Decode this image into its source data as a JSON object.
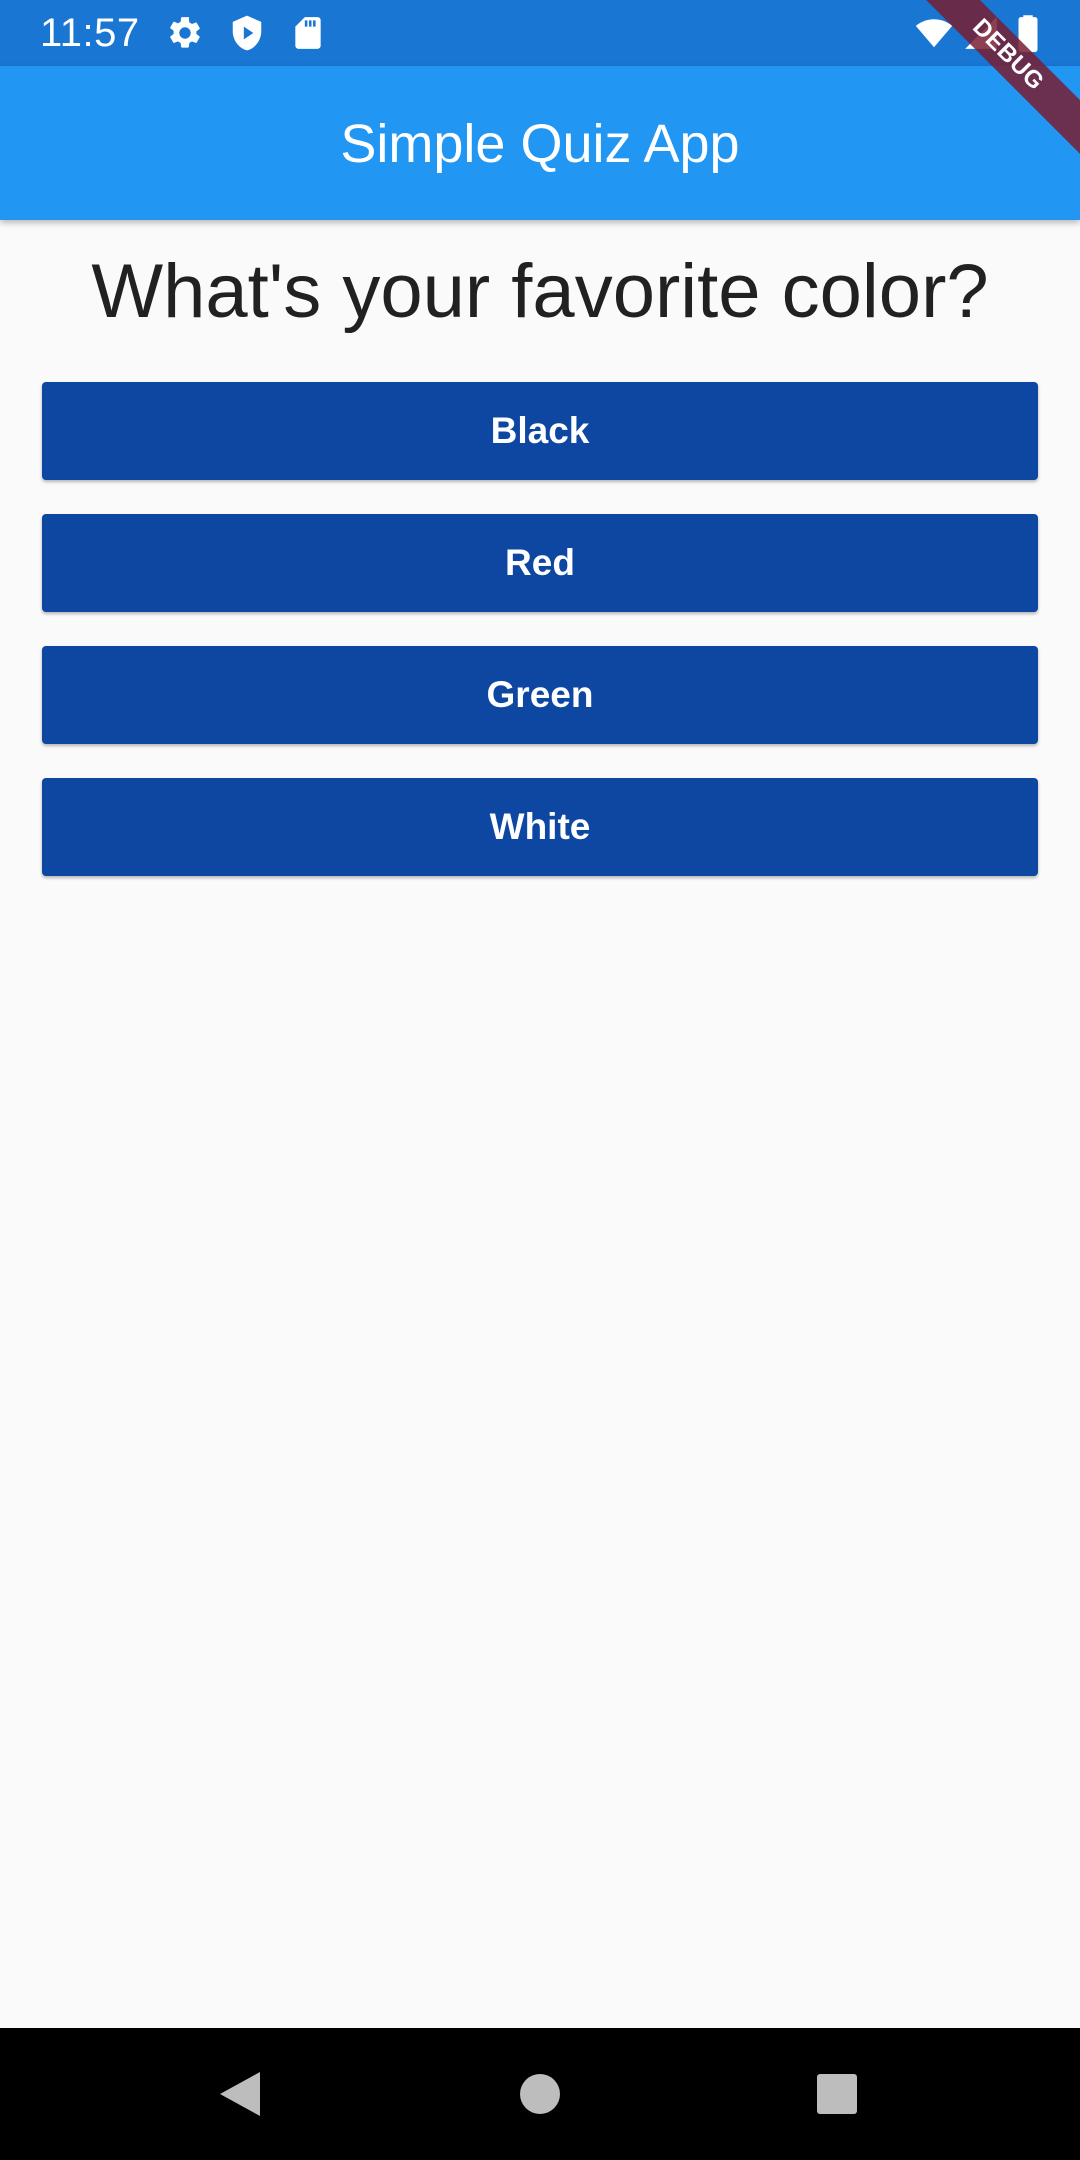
{
  "status_bar": {
    "time": "11:57",
    "icons": [
      "gear-icon",
      "shield-play-icon",
      "sd-card-icon",
      "wifi-icon",
      "signal-icon",
      "battery-icon"
    ],
    "background": "#1976D2"
  },
  "app_bar": {
    "title": "Simple Quiz App",
    "background": "#2196F3"
  },
  "debug_banner": {
    "label": "DEBUG"
  },
  "quiz": {
    "question": "What's your favorite color?",
    "answers": [
      {
        "label": "Black"
      },
      {
        "label": "Red"
      },
      {
        "label": "Green"
      },
      {
        "label": "White"
      }
    ],
    "button_color": "#0D47A1"
  },
  "nav_bar": {
    "buttons": [
      "back-icon",
      "home-icon",
      "recents-icon"
    ]
  }
}
